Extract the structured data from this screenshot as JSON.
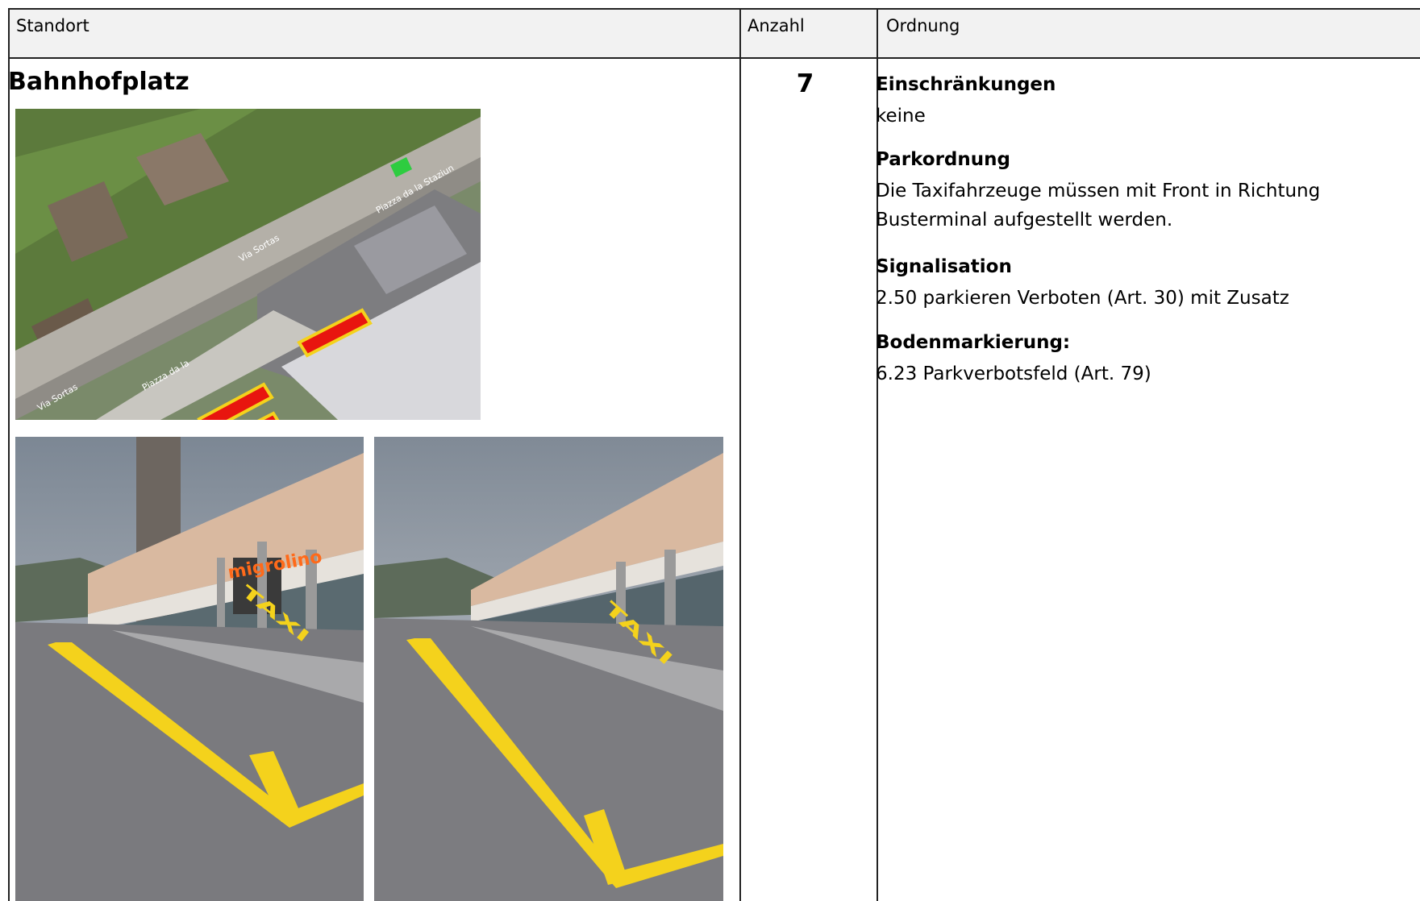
{
  "table": {
    "headers": {
      "location": "Standort",
      "count": "Anzahl",
      "order": "Ordnung"
    }
  },
  "entry": {
    "location": "Bahnhofplatz",
    "count": "7",
    "sections": [
      {
        "heading": "Einschränkungen",
        "text": "keine"
      },
      {
        "heading": "Parkordnung",
        "text": "Die Taxifahrzeuge müssen mit Front in Richtung Busterminal aufgestellt werden."
      },
      {
        "heading": "Signalisation",
        "text": "2.50 parkieren Verboten (Art. 30) mit Zusatz"
      },
      {
        "heading": "Bodenmarkierung:",
        "text": "6.23 Parkverbotsfeld (Art. 79)"
      }
    ]
  },
  "aerial": {
    "street_labels": [
      "Via Sortas",
      "Via Sortas",
      "Piazza da la",
      "Piazza da la Staziun"
    ]
  },
  "photo1": {
    "shop_sign": "migrolino",
    "marking": "TAXI"
  },
  "photo2": {
    "marking": "TAXI"
  },
  "colors": {
    "marking_yellow": "#f4d21c",
    "taxi_zone_red": "#e8150f",
    "header_bg": "#f2f2f2"
  }
}
